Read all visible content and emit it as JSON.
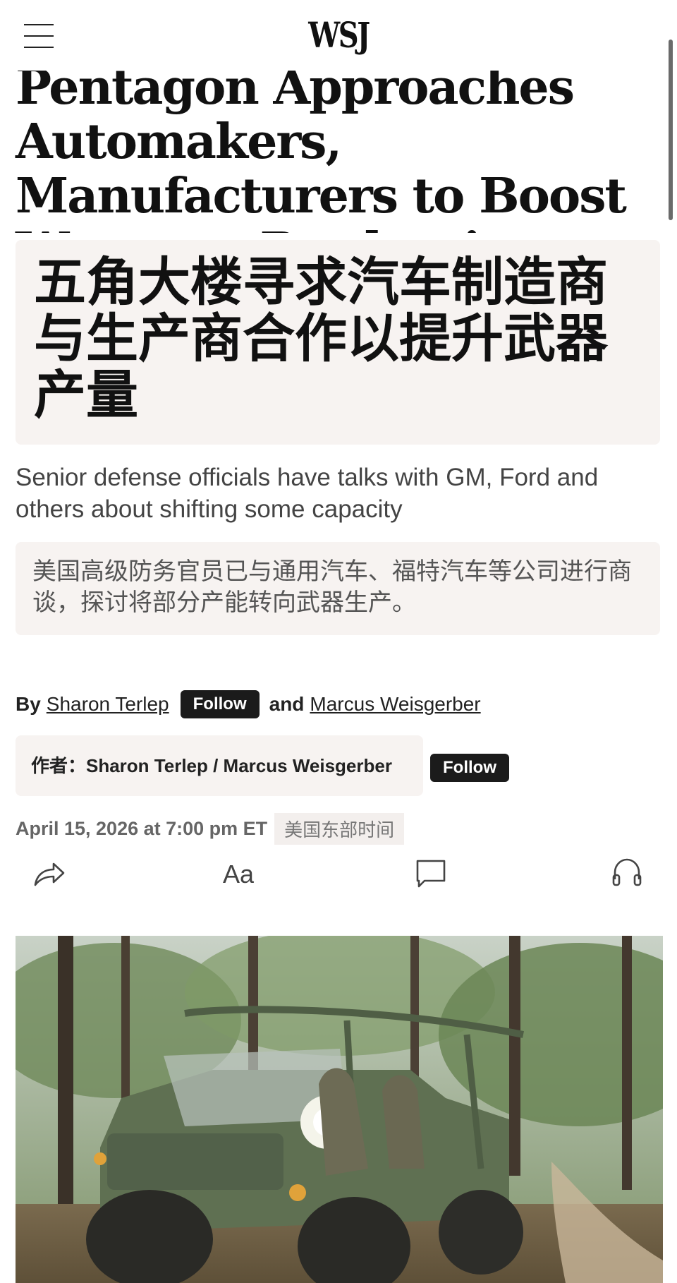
{
  "header": {
    "logo": "WSJ",
    "menu_icon": "hamburger-menu-icon"
  },
  "article": {
    "headline": "Pentagon Approaches Automakers, Manufacturers to Boost Weapons Production",
    "headline_translation": "五角大楼寻求汽车制造商与生产商合作以提升武器产量",
    "dek": "Senior defense officials have talks with GM, Ford and others about shifting some capacity",
    "dek_translation": "美国高级防务官员已与通用汽车、福特汽车等公司进行商谈，探讨将部分产能转向武器生产。",
    "byline": {
      "by": "By",
      "author1": "Sharon Terlep",
      "follow_label": "Follow",
      "and": "and",
      "author2": "Marcus Weisgerber"
    },
    "byline_translation": "作者：Sharon Terlep / Marcus Weisgerber",
    "byline_translation_follow": "Follow",
    "date": "April 15, 2026 at 7:00 pm ET",
    "timezone_translation": "美国东部时间"
  },
  "toolbar": {
    "share_icon": "share-icon",
    "text_size_label": "Aa",
    "comments_icon": "comment-icon",
    "listen_icon": "headphones-icon"
  },
  "hero_image": {
    "description_icon": "military-vehicle-photo"
  },
  "colors": {
    "text": "#111111",
    "translation_box": "#f7f3f1",
    "button": "#1b1b1b",
    "muted": "#666666"
  }
}
